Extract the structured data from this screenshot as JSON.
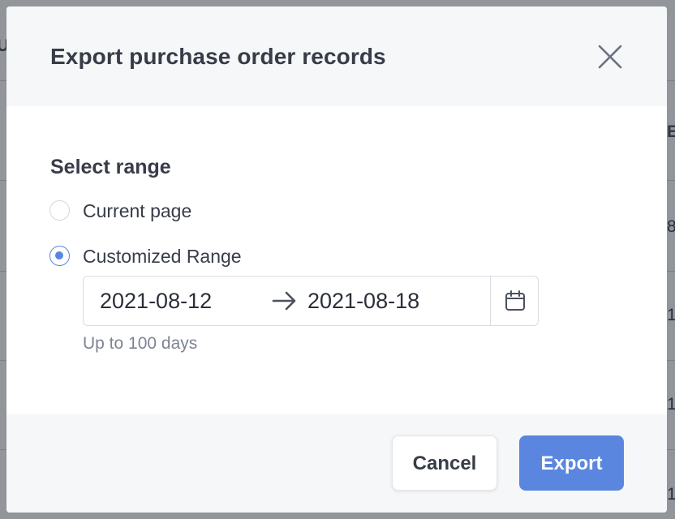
{
  "background": {
    "header_fragments": [
      "U",
      "E"
    ],
    "row_fragments": [
      "8",
      "1",
      "1",
      "1"
    ]
  },
  "modal": {
    "title": "Export purchase order records",
    "close_icon": "close-icon",
    "section_title": "Select range",
    "options": [
      {
        "label": "Current page",
        "selected": false
      },
      {
        "label": "Customized Range",
        "selected": true
      }
    ],
    "range": {
      "start": "2021-08-12",
      "end": "2021-08-18",
      "separator_icon": "arrow-right-icon",
      "calendar_icon": "calendar-icon"
    },
    "hint": "Up to 100 days",
    "buttons": {
      "cancel": "Cancel",
      "export": "Export"
    }
  },
  "colors": {
    "accent": "#5b86e0",
    "title_text": "#373c48",
    "muted_text": "#7c8594",
    "header_bg": "#f6f7f8"
  }
}
